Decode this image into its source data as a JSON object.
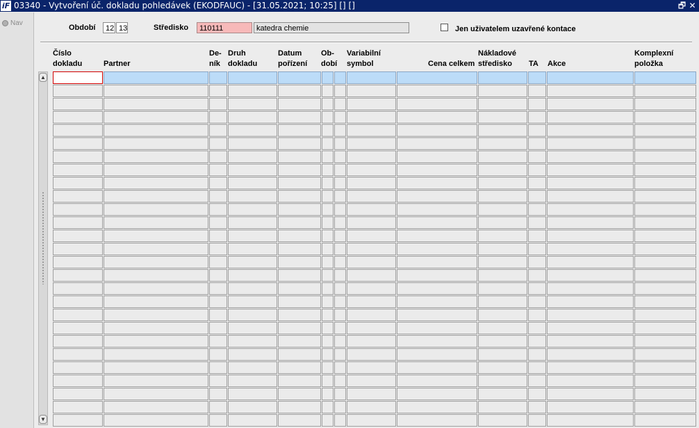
{
  "window": {
    "title": "03340 - Vytvoření úč. dokladu pohledávek (EKODFAUC) - [31.05.2021; 10:25] [] []",
    "app_icon": "ifis-logo-icon",
    "restore_icon": "restore-window-icon",
    "close_icon": "close-window-icon",
    "restore_glyph": "🗗",
    "close_glyph": "✕"
  },
  "nav": {
    "label": "Nav"
  },
  "filters": {
    "obdobi_label": "Období",
    "obdobi_from": "12",
    "obdobi_to": "13",
    "stredisko_label": "Středisko",
    "stredisko_code": "110111",
    "stredisko_name": "katedra chemie",
    "closed_by_user_label": "Jen uživatelem uzavřené kontace",
    "closed_by_user_checked": false
  },
  "table": {
    "headers": {
      "cislo": [
        "Číslo",
        "dokladu"
      ],
      "partner": "Partner",
      "denik": [
        "De-",
        "ník"
      ],
      "druh": [
        "Druh",
        "dokladu"
      ],
      "datum": [
        "Datum",
        "pořízení"
      ],
      "obdobi": [
        "Ob-",
        "dobí"
      ],
      "vs": [
        "Variabilní",
        "symbol"
      ],
      "cena": "Cena celkem",
      "nakl": [
        "Nákladové",
        "středisko"
      ],
      "ta": "TA",
      "akce": "Akce",
      "kompl": [
        "Komplexní",
        "položka"
      ]
    },
    "row_count": 27,
    "current_row": 0
  },
  "colors": {
    "titlebar": "#0a246a",
    "current_row": "#bcdcf8",
    "required_field": "#f7b9b9",
    "focus_border": "#d00000"
  }
}
